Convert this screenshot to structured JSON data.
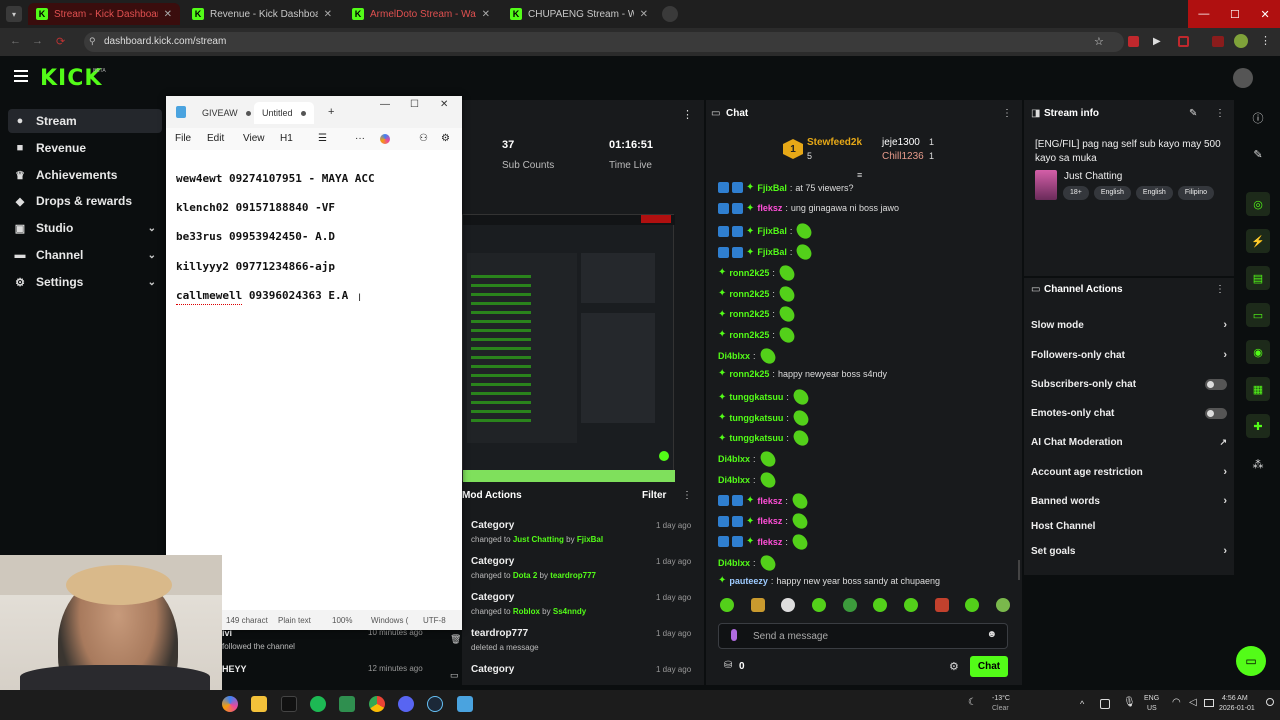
{
  "browser": {
    "tabs": [
      {
        "label": "Stream - Kick Dashboard"
      },
      {
        "label": "Revenue - Kick Dashboard"
      },
      {
        "label": "ArmelDoto Stream - Watch Live"
      },
      {
        "label": "CHUPAENG Stream - Watch Live"
      }
    ],
    "url": "dashboard.kick.com/stream"
  },
  "kick": {
    "logo": "KICK",
    "logo_badge": "BETA"
  },
  "sidebar": {
    "items": [
      {
        "label": "Stream",
        "icon": "dot-icon",
        "active": true
      },
      {
        "label": "Revenue",
        "icon": "revenue-icon"
      },
      {
        "label": "Achievements",
        "icon": "trophy-icon"
      },
      {
        "label": "Drops & rewards",
        "icon": "gift-icon"
      },
      {
        "label": "Studio",
        "icon": "studio-icon",
        "expandable": true
      },
      {
        "label": "Channel",
        "icon": "channel-icon",
        "expandable": true
      },
      {
        "label": "Settings",
        "icon": "gear-icon",
        "expandable": true
      }
    ]
  },
  "notepad": {
    "tabs": [
      {
        "label": "GIVEAW"
      },
      {
        "label": "Untitled"
      }
    ],
    "menu": [
      "File",
      "Edit",
      "View",
      "H1"
    ],
    "lines": [
      "wew4ewt 09274107951 - MAYA ACC",
      "klench02 09157188840 -VF",
      "be33rus 09953942450- A.D",
      "killyyy2 09771234866-ajp",
      "callmewell 09396024363 E.A"
    ],
    "status": {
      "chars": "149 charact",
      "format": "Plain text",
      "zoom": "100%",
      "eol": "Windows (",
      "encoding": "UTF-8"
    }
  },
  "stats": {
    "sub_count_value": "37",
    "sub_count_label": "Sub Counts",
    "time_live_value": "01:16:51",
    "time_live_label": "Time Live"
  },
  "mod_actions": {
    "title": "Mod Actions",
    "filter": "Filter",
    "rows": [
      {
        "title": "Category",
        "prefix": "changed to",
        "target": "Just Chatting",
        "by": "by",
        "who": "FjixBal",
        "time": "1 day ago"
      },
      {
        "title": "Category",
        "prefix": "changed to",
        "target": "Dota 2",
        "by": "by",
        "who": "teardrop777",
        "time": "1 day ago"
      },
      {
        "title": "Category",
        "prefix": "changed to",
        "target": "Roblox",
        "by": "by",
        "who": "Ss4nndy",
        "time": "1 day ago"
      },
      {
        "title": "teardrop777",
        "prefix": "deleted a message",
        "target": "",
        "by": "",
        "who": "",
        "time": "1 day ago"
      },
      {
        "title": "Category",
        "prefix": "",
        "target": "",
        "by": "",
        "who": "",
        "time": "1 day ago"
      }
    ]
  },
  "activity": {
    "rows": [
      {
        "user": "ivi",
        "text": "followed the channel",
        "time": "10 minutes ago"
      },
      {
        "user": "HEYY",
        "text": "",
        "time": "12 minutes ago"
      }
    ]
  },
  "chat": {
    "title": "Chat",
    "top_gifters": [
      {
        "name": "Stewfeed2k",
        "count": "5"
      },
      {
        "name": "jeje1300",
        "count": "1"
      },
      {
        "name": "Chill1236",
        "count": "1"
      }
    ],
    "top_rank": "1",
    "messages": [
      {
        "user": "FjixBal",
        "text": "at 75 viewers?",
        "color": "#53fc18",
        "badges": 3,
        "emote": false
      },
      {
        "user": "fleksz",
        "text": "ung ginagawa ni boss jawo",
        "color": "#ff4fd8",
        "badges": 3,
        "emote": false
      },
      {
        "user": "FjixBal",
        "text": "",
        "color": "#53fc18",
        "badges": 3,
        "emote": true
      },
      {
        "user": "FjixBal",
        "text": "",
        "color": "#53fc18",
        "badges": 3,
        "emote": true
      },
      {
        "user": "ronn2k25",
        "text": "",
        "color": "#53fc18",
        "badges": 1,
        "emote": true
      },
      {
        "user": "ronn2k25",
        "text": "",
        "color": "#53fc18",
        "badges": 1,
        "emote": true
      },
      {
        "user": "ronn2k25",
        "text": "",
        "color": "#53fc18",
        "badges": 1,
        "emote": true
      },
      {
        "user": "ronn2k25",
        "text": "",
        "color": "#53fc18",
        "badges": 1,
        "emote": true
      },
      {
        "user": "Di4blxx",
        "text": "",
        "color": "#53fc18",
        "badges": 0,
        "emote": true
      },
      {
        "user": "ronn2k25",
        "text": "happy newyear boss s4ndy",
        "color": "#53fc18",
        "badges": 1,
        "emote": false
      },
      {
        "user": "tunggkatsuu",
        "text": "",
        "color": "#53fc18",
        "badges": 1,
        "emote": true
      },
      {
        "user": "tunggkatsuu",
        "text": "",
        "color": "#53fc18",
        "badges": 1,
        "emote": true
      },
      {
        "user": "tunggkatsuu",
        "text": "",
        "color": "#53fc18",
        "badges": 1,
        "emote": true
      },
      {
        "user": "Di4blxx",
        "text": "",
        "color": "#53fc18",
        "badges": 0,
        "emote": true
      },
      {
        "user": "Di4blxx",
        "text": "",
        "color": "#53fc18",
        "badges": 0,
        "emote": true
      },
      {
        "user": "fleksz",
        "text": "",
        "color": "#ff4fd8",
        "badges": 3,
        "emote": true
      },
      {
        "user": "fleksz",
        "text": "",
        "color": "#ff4fd8",
        "badges": 3,
        "emote": true
      },
      {
        "user": "fleksz",
        "text": "",
        "color": "#ff4fd8",
        "badges": 3,
        "emote": true
      },
      {
        "user": "Di4blxx",
        "text": "",
        "color": "#53fc18",
        "badges": 0,
        "emote": true
      },
      {
        "user": "pauteezy",
        "text": "happy new year boss sandy at chupaeng",
        "color": "#9ecbff",
        "badges": 1,
        "emote": false
      }
    ],
    "input_placeholder": "Send a message",
    "points": "0",
    "send_label": "Chat"
  },
  "stream_info": {
    "title": "Stream info",
    "stream_title": "[ENG/FIL] pag nag self sub kayo may 500 kayo sa muka",
    "category": "Just Chatting",
    "tags": [
      "18+",
      "English",
      "English",
      "Filipino"
    ]
  },
  "channel_actions": {
    "title": "Channel Actions",
    "items": [
      {
        "label": "Slow mode",
        "control": "chevron"
      },
      {
        "label": "Followers-only chat",
        "control": "chevron"
      },
      {
        "label": "Subscribers-only chat",
        "control": "toggle"
      },
      {
        "label": "Emotes-only chat",
        "control": "toggle"
      },
      {
        "label": "AI Chat Moderation",
        "control": "external"
      },
      {
        "label": "Account age restriction",
        "control": "chevron"
      },
      {
        "label": "Banned words",
        "control": "chevron"
      },
      {
        "label": "Host Channel",
        "control": "none"
      },
      {
        "label": "Set goals",
        "control": "chevron"
      }
    ]
  },
  "taskbar": {
    "weather_temp": "-13°C",
    "weather_text": "Clear",
    "lang_top": "ENG",
    "lang_bottom": "US",
    "time": "4:56 AM",
    "date": "2026-01-01"
  },
  "colors": {
    "accent": "#53fc18",
    "panel": "#181a1c",
    "bg": "#0b0e0f"
  }
}
